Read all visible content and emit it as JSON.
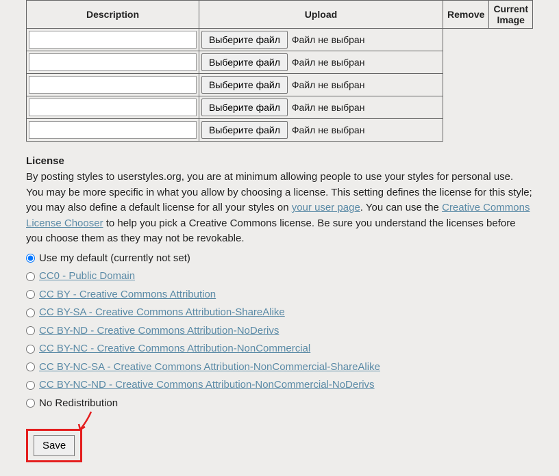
{
  "table": {
    "headers": {
      "description": "Description",
      "upload": "Upload",
      "remove": "Remove",
      "current_image": "Current Image"
    },
    "rows": [
      {
        "desc": "",
        "file_btn": "Выберите файл",
        "file_status": "Файл не выбран"
      },
      {
        "desc": "",
        "file_btn": "Выберите файл",
        "file_status": "Файл не выбран"
      },
      {
        "desc": "",
        "file_btn": "Выберите файл",
        "file_status": "Файл не выбран"
      },
      {
        "desc": "",
        "file_btn": "Выберите файл",
        "file_status": "Файл не выбран"
      },
      {
        "desc": "",
        "file_btn": "Выберите файл",
        "file_status": "Файл не выбран"
      }
    ]
  },
  "license": {
    "heading": "License",
    "desc_parts": {
      "p1": "By posting styles to userstyles.org, you are at minimum allowing people to use your styles for personal use. You may be more specific in what you allow by choosing a license. This setting defines the license for this style; you may also define a default license for all your styles on ",
      "link1": "your user page",
      "p2": ". You can use the ",
      "link2": "Creative Commons License Chooser",
      "p3": " to help you pick a Creative Commons license. Be sure you understand the licenses before you choose them as they may not be revokable."
    },
    "options": [
      {
        "label": "Use my default (currently not set)",
        "is_link": false,
        "checked": true
      },
      {
        "label": "CC0 - Public Domain",
        "is_link": true,
        "checked": false
      },
      {
        "label": "CC BY - Creative Commons Attribution",
        "is_link": true,
        "checked": false
      },
      {
        "label": "CC BY-SA - Creative Commons Attribution-ShareAlike",
        "is_link": true,
        "checked": false
      },
      {
        "label": "CC BY-ND - Creative Commons Attribution-NoDerivs",
        "is_link": true,
        "checked": false
      },
      {
        "label": "CC BY-NC - Creative Commons Attribution-NonCommercial",
        "is_link": true,
        "checked": false
      },
      {
        "label": "CC BY-NC-SA - Creative Commons Attribution-NonCommercial-ShareAlike",
        "is_link": true,
        "checked": false
      },
      {
        "label": "CC BY-NC-ND - Creative Commons Attribution-NonCommercial-NoDerivs",
        "is_link": true,
        "checked": false
      },
      {
        "label": "No Redistribution",
        "is_link": false,
        "checked": false
      }
    ]
  },
  "buttons": {
    "save": "Save"
  },
  "annotation": {
    "highlight_color": "#e41e1e"
  }
}
